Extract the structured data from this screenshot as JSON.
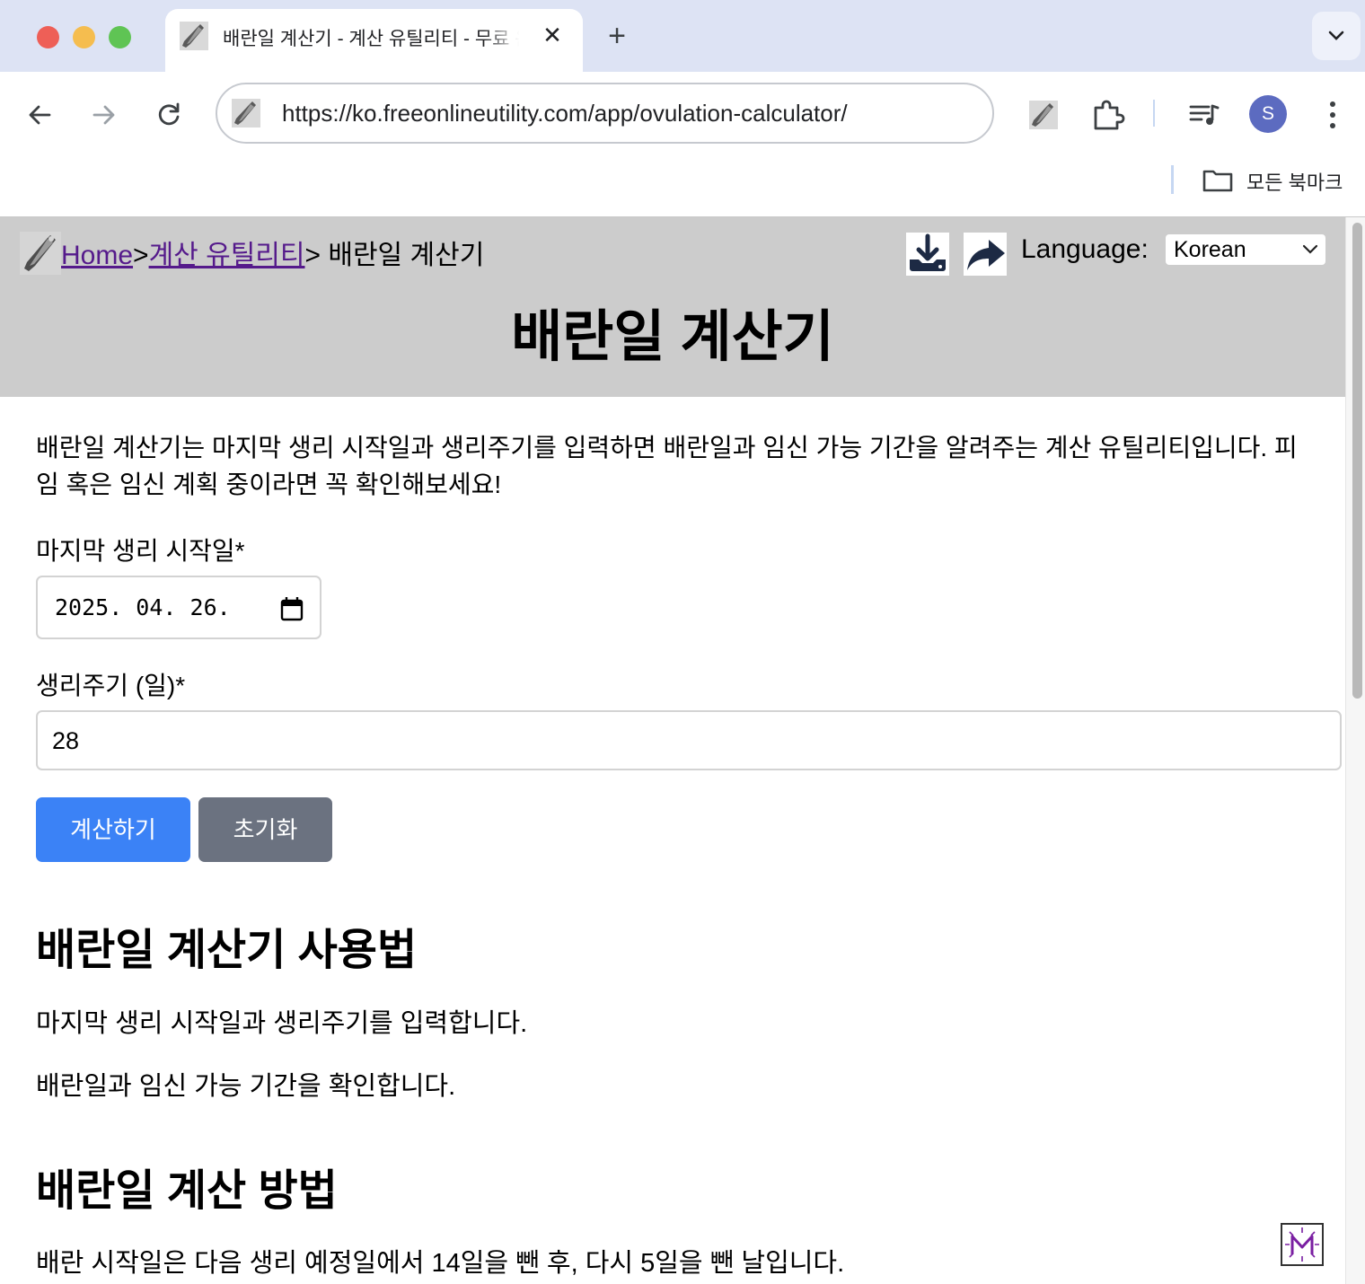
{
  "browser": {
    "tab_title": "배란일 계산기 - 계산 유틸리티 - 무료 온라인 유틸리티",
    "new_tab_symbol": "+",
    "close_symbol": "✕",
    "url": "https://ko.freeonlineutility.com/app/ovulation-calculator/",
    "profile_initial": "S",
    "bookmarks_label": "모든 북마크"
  },
  "header": {
    "breadcrumb_home": "Home",
    "breadcrumb_sep1": ">",
    "breadcrumb_category": "계산 유틸리티",
    "breadcrumb_current": "> 배란일 계산기",
    "language_label": "Language:",
    "language_value": "Korean",
    "title": "배란일 계산기"
  },
  "main": {
    "intro": "배란일 계산기는 마지막 생리 시작일과 생리주기를 입력하면 배란일과 임신 가능 기간을 알려주는 계산 유틸리티입니다. 피임 혹은 임신 계획 중이라면 꼭 확인해보세요!",
    "last_period_label": "마지막 생리 시작일*",
    "last_period_value": "2025. 04. 26.",
    "cycle_label": "생리주기 (일)*",
    "cycle_value": "28",
    "calculate_button": "계산하기",
    "reset_button": "초기화",
    "howto_heading": "배란일 계산기 사용법",
    "howto_step1": "마지막 생리 시작일과 생리주기를 입력합니다.",
    "howto_step2": "배란일과 임신 가능 기간을 확인합니다.",
    "method_heading": "배란일 계산 방법",
    "method_text": "배란 시작일은 다음 생리 예정일에서 14일을 뺀 후, 다시 5일을 뺀 날입니다."
  },
  "colors": {
    "primary_button": "#3b82f6",
    "secondary_button": "#6b7280",
    "header_bg": "#cccccc",
    "link": "#551a8b"
  }
}
